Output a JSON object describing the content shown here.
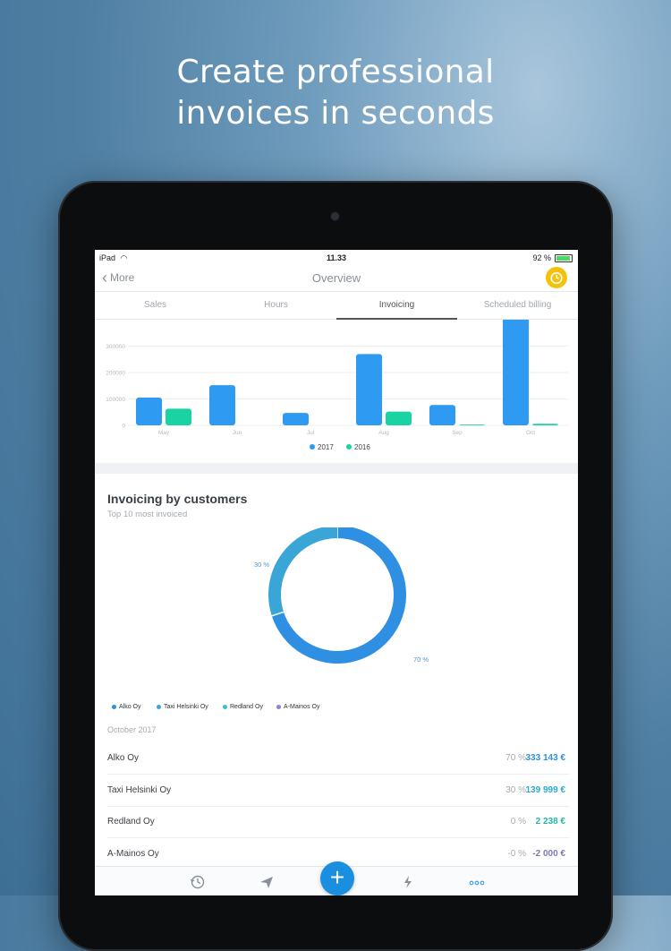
{
  "headline": {
    "line1": "Create professional",
    "line2": "invoices in seconds"
  },
  "statusbar": {
    "device": "iPad",
    "time": "11.33",
    "battery": "92 %",
    "battery_level": 0.92
  },
  "navbar": {
    "back_label": "More",
    "title": "Overview"
  },
  "tabs": [
    {
      "label": "Sales",
      "active": false
    },
    {
      "label": "Hours",
      "active": false
    },
    {
      "label": "Invoicing",
      "active": true
    },
    {
      "label": "Scheduled billing",
      "active": false
    }
  ],
  "colors": {
    "accent": "#1a8fe0",
    "series_2017": "#2e9af2",
    "series_2016": "#19d4a2",
    "timer": "#f4c20d"
  },
  "chart_data": [
    {
      "type": "bar",
      "categories": [
        "May",
        "Jun",
        "Jul",
        "Aug",
        "Sep",
        "Oct"
      ],
      "series": [
        {
          "name": "2017",
          "values": [
            105000,
            152000,
            47000,
            270000,
            77000,
            460000
          ]
        },
        {
          "name": "2016",
          "values": [
            63000,
            0,
            0,
            52000,
            3000,
            6000
          ]
        }
      ],
      "ytick_labels": [
        "0",
        "100000",
        "200000",
        "300000"
      ],
      "ylim": [
        0,
        400000
      ],
      "legend": "bottom",
      "grid": true
    },
    {
      "type": "pie",
      "title": "Invoicing by customers",
      "subtitle": "Top 10 most invoiced",
      "labels": [
        "Alko Oy",
        "Taxi Helsinki Oy",
        "Redland Oy",
        "A-Mainos Oy"
      ],
      "values": [
        70,
        30,
        0,
        0
      ],
      "slice_labels": [
        "70 %",
        "30 %"
      ],
      "colors": [
        "#2e8fe3",
        "#3aa6d8",
        "#36bed4",
        "#8b7fe0"
      ],
      "legend": "bottom"
    }
  ],
  "table": {
    "period": "October 2017",
    "rows": [
      {
        "name": "Alko Oy",
        "pct": "70 %",
        "amount": "333 143 €",
        "color": "#2e8fe3"
      },
      {
        "name": "Taxi Helsinki Oy",
        "pct": "30 %",
        "amount": "139 999 €",
        "color": "#2aa8d0"
      },
      {
        "name": "Redland Oy",
        "pct": "0 %",
        "amount": "2 238 €",
        "color": "#22b8a0"
      },
      {
        "name": "A-Mainos Oy",
        "pct": "-0 %",
        "amount": "-2 000 €",
        "color": "#7d7ab0"
      }
    ]
  },
  "bottom_nav": [
    {
      "icon": "history-icon"
    },
    {
      "icon": "send-icon"
    },
    {
      "icon": "add-icon",
      "label": "+"
    },
    {
      "icon": "flash-icon"
    },
    {
      "icon": "more-icon"
    }
  ]
}
